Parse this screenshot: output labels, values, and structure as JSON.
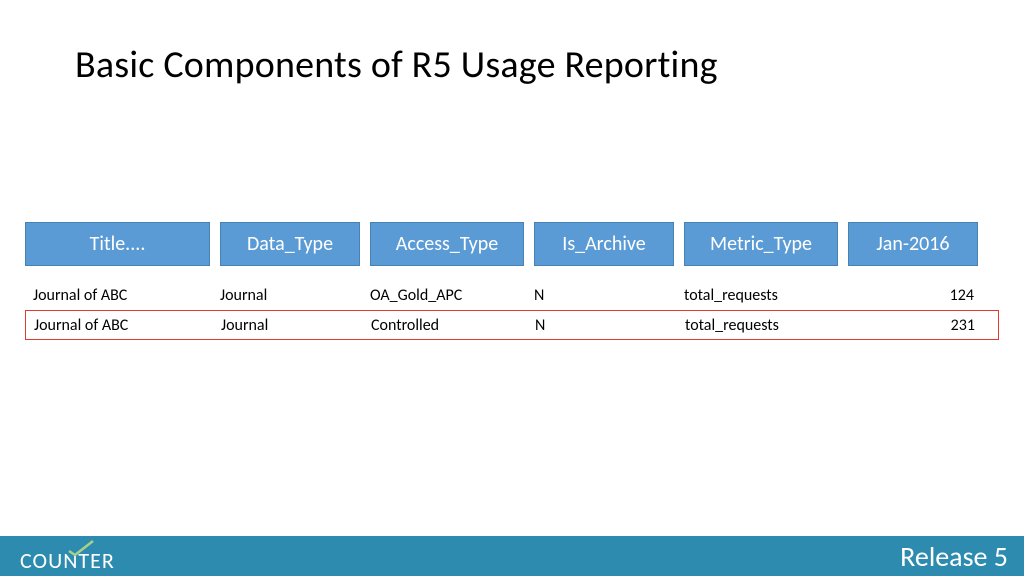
{
  "title": "Basic Components of R5 Usage Reporting",
  "headers": {
    "title": "Title....",
    "data_type": "Data_Type",
    "access_type": "Access_Type",
    "is_archive": "Is_Archive",
    "metric_type": "Metric_Type",
    "month": "Jan-2016"
  },
  "rows": [
    {
      "title": "Journal of ABC",
      "data_type": "Journal",
      "access_type": "OA_Gold_APC",
      "is_archive": "N",
      "metric_type": "total_requests",
      "value": "124",
      "highlight": false
    },
    {
      "title": "Journal of ABC",
      "data_type": "Journal",
      "access_type": "Controlled",
      "is_archive": "N",
      "metric_type": "total_requests",
      "value": "231",
      "highlight": true
    }
  ],
  "footer": {
    "logo": "COUNTER",
    "release": "Release 5"
  }
}
